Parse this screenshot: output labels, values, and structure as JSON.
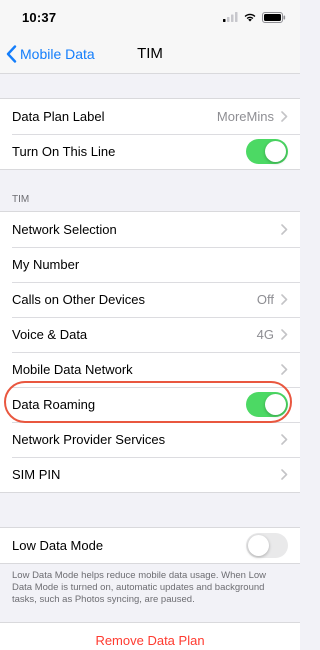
{
  "status_bar": {
    "time": "10:37"
  },
  "nav": {
    "back_label": "Mobile Data",
    "title": "TIM"
  },
  "group1": {
    "data_plan_label": {
      "label": "Data Plan Label",
      "value": "MoreMins"
    },
    "turn_on_line": {
      "label": "Turn On This Line",
      "toggle": "on"
    }
  },
  "section_tim": {
    "header": "TIM"
  },
  "group2": {
    "network_selection": {
      "label": "Network Selection"
    },
    "my_number": {
      "label": "My Number"
    },
    "calls_other_devices": {
      "label": "Calls on Other Devices",
      "value": "Off"
    },
    "voice_data": {
      "label": "Voice & Data",
      "value": "4G"
    },
    "mobile_data_network": {
      "label": "Mobile Data Network"
    },
    "data_roaming": {
      "label": "Data Roaming",
      "toggle": "on"
    },
    "network_provider_services": {
      "label": "Network Provider Services"
    },
    "sim_pin": {
      "label": "SIM PIN"
    }
  },
  "group3": {
    "low_data_mode": {
      "label": "Low Data Mode",
      "toggle": "off"
    },
    "footer": "Low Data Mode helps reduce mobile data usage. When Low Data Mode is turned on, automatic updates and background tasks, such as Photos syncing, are paused."
  },
  "remove_plan": {
    "label": "Remove Data Plan"
  },
  "colors": {
    "accent": "#147efb",
    "toggle_on": "#4cd964",
    "destructive": "#ff3b30",
    "highlight": "#e9573f"
  },
  "icons": [
    "cellular-signal-icon",
    "wifi-icon",
    "battery-icon",
    "chevron-left-icon",
    "chevron-right-icon"
  ]
}
